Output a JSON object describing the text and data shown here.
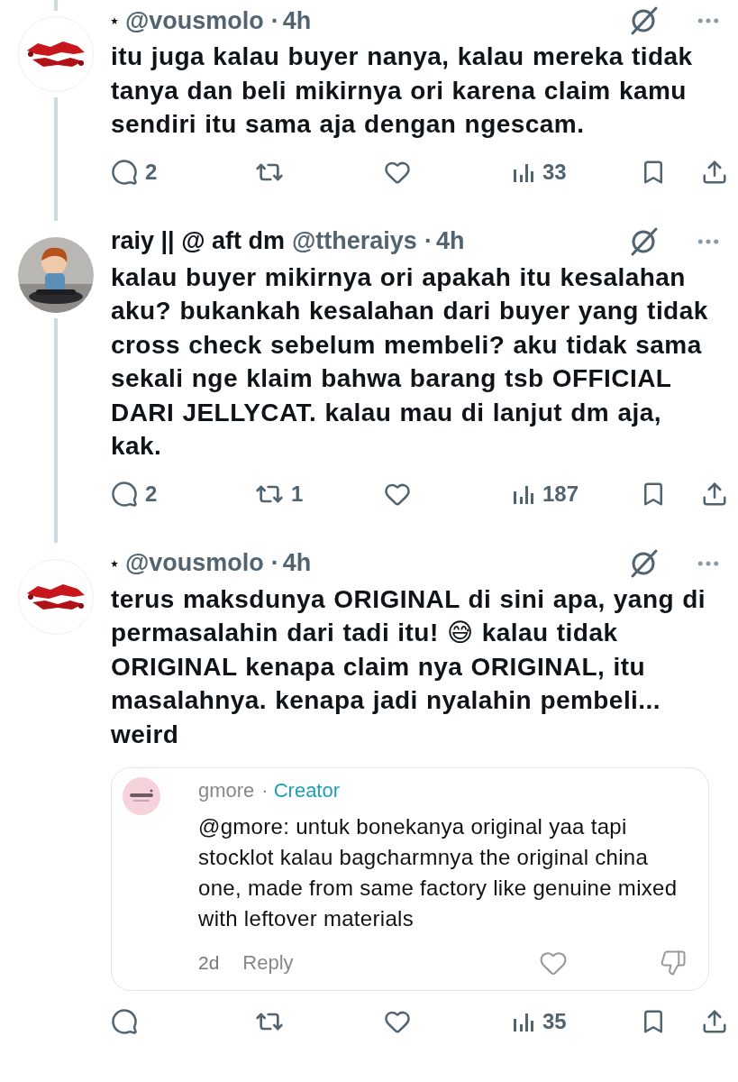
{
  "tweets": [
    {
      "avatar": {
        "kind": "logo"
      },
      "starred": true,
      "handle": "@vousmolo",
      "separator": "·",
      "time": "4h",
      "thread_above": true,
      "thread_below": true,
      "text": "itu juga kalau buyer nanya, kalau mereka tidak tanya dan beli mikirnya ori karena claim kamu sendiri itu sama aja dengan ngescam.",
      "stats": {
        "replies": "2",
        "views": "33"
      }
    },
    {
      "avatar": {
        "kind": "figure"
      },
      "starred": false,
      "display_name": "raiy || @ aft dm",
      "handle": "@ttheraiys",
      "separator": "·",
      "time": "4h",
      "thread_above": false,
      "thread_below": true,
      "text": "kalau buyer mikirnya ori apakah itu kesalahan aku? bukankah kesalahan dari buyer yang tidak cross check sebelum membeli? aku tidak sama sekali nge klaim bahwa barang tsb OFFICIAL DARI JELLYCAT. kalau mau di lanjut dm aja, kak.",
      "stats": {
        "replies": "2",
        "reposts": "1",
        "views": "187"
      }
    },
    {
      "avatar": {
        "kind": "logo"
      },
      "starred": true,
      "handle": "@vousmolo",
      "separator": "·",
      "time": "4h",
      "thread_above": false,
      "thread_below": false,
      "text": "terus maksdunya ORIGINAL di sini apa, yang di permasalahin dari tadi itu! 😅 kalau tidak ORIGINAL kenapa claim nya ORIGINAL, itu masalahnya. kenapa jadi nyalahin pembeli... weird",
      "quote": {
        "name": "gmore",
        "separator": "·",
        "badge": "Creator",
        "text": "@gmore: untuk bonekanya original yaa tapi stocklot kalau bagcharmnya the original china one, made from same factory like genuine mixed with leftover materials",
        "time": "2d",
        "reply_label": "Reply"
      },
      "stats": {
        "views": "35"
      }
    }
  ]
}
